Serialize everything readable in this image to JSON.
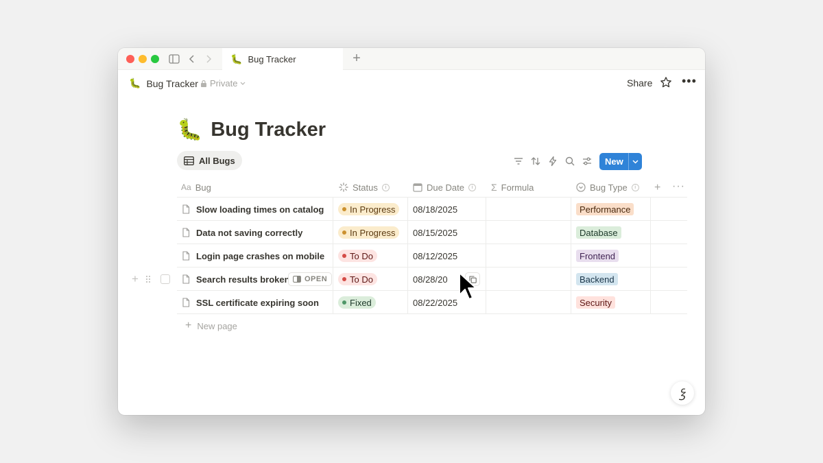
{
  "browser": {
    "tab_title": "Bug Tracker",
    "tab_emoji": "🐛",
    "new_tab_label": "+"
  },
  "topbar": {
    "breadcrumb_emoji": "🐛",
    "breadcrumb_title": "Bug Tracker",
    "privacy_label": "Private",
    "share_label": "Share"
  },
  "page": {
    "emoji": "🐛",
    "title": "Bug Tracker"
  },
  "view": {
    "tab_label": "All Bugs",
    "new_button_label": "New"
  },
  "table": {
    "columns": [
      {
        "label": "Bug",
        "icon": "title-icon"
      },
      {
        "label": "Status",
        "icon": "status-icon"
      },
      {
        "label": "Due Date",
        "icon": "calendar-icon"
      },
      {
        "label": "Formula",
        "icon": "sigma-icon"
      },
      {
        "label": "Bug Type",
        "icon": "select-icon"
      }
    ],
    "rows": [
      {
        "bug": "Slow loading times on catalog",
        "status": "In Progress",
        "due": "08/18/2025",
        "type": "Performance"
      },
      {
        "bug": "Data not saving correctly",
        "status": "In Progress",
        "due": "08/15/2025",
        "type": "Database"
      },
      {
        "bug": "Login page crashes on mobile",
        "status": "To Do",
        "due": "08/12/2025",
        "type": "Frontend"
      },
      {
        "bug": "Search results broken",
        "status": "To Do",
        "due": "08/28/20",
        "type": "Backend"
      },
      {
        "bug": "SSL certificate expiring soon",
        "status": "Fixed",
        "due": "08/22/2025",
        "type": "Security"
      }
    ],
    "open_label": "OPEN",
    "new_page_label": "New page"
  },
  "colors": {
    "accent": "#2f83d8",
    "status_in_progress_bg": "#fbeccc",
    "status_in_progress_dot": "#cb912f",
    "status_in_progress_text": "#5c3b12",
    "status_todo_bg": "#fde4e2",
    "status_todo_dot": "#d44c47",
    "status_todo_text": "#5d1715",
    "status_fixed_bg": "#dbeddb",
    "status_fixed_dot": "#4f9768",
    "status_fixed_text": "#1c3829",
    "type_performance_bg": "#fadec9",
    "type_performance_text": "#49290e",
    "type_database_bg": "#dbeddb",
    "type_database_text": "#1c3829",
    "type_frontend_bg": "#e8deee",
    "type_frontend_text": "#412454",
    "type_backend_bg": "#d3e5ef",
    "type_backend_text": "#183347",
    "type_security_bg": "#ffe2dd",
    "type_security_text": "#5d1715"
  }
}
